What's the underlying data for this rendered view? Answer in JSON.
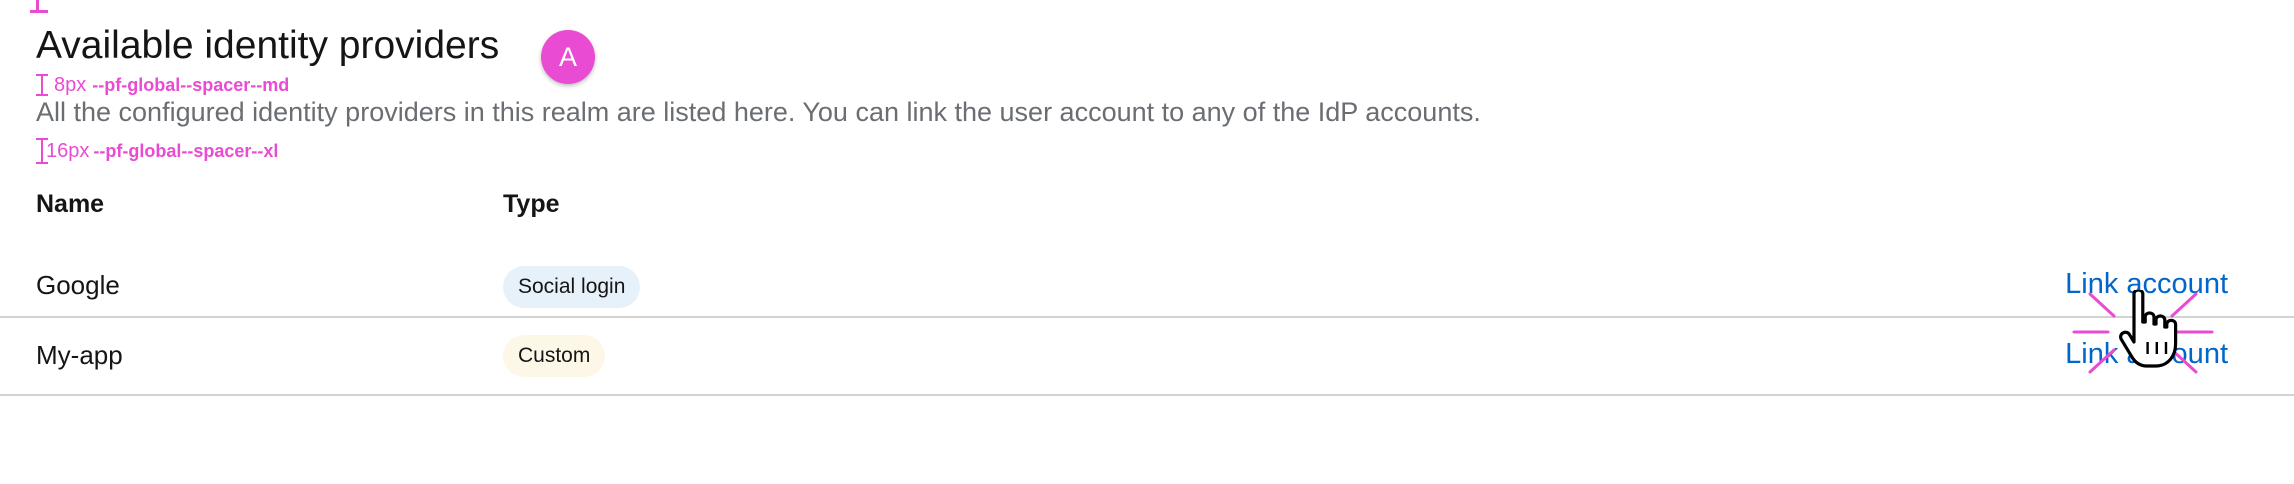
{
  "header": {
    "title": "Available identity providers",
    "callout": "A",
    "description": "All the configured identity providers in this realm are listed here. You can link the user account to any of the IdP accounts."
  },
  "annotations": {
    "spacer_md": {
      "value": "8px",
      "variable": "--pf-global--spacer--md"
    },
    "spacer_xl": {
      "value": "16px",
      "variable": "--pf-global--spacer--xl"
    }
  },
  "table": {
    "columns": [
      "Name",
      "Type"
    ],
    "rows": [
      {
        "name": "Google",
        "type": "Social login",
        "action": "Link account"
      },
      {
        "name": "My-app",
        "type": "Custom",
        "action": "Link account"
      }
    ]
  },
  "colors": {
    "annotation": "#e94cd2",
    "link": "#0066cc",
    "social_label_bg": "#e7f1fa",
    "custom_label_bg": "#fdf7e7",
    "description_text": "#6a6e73"
  },
  "icons": {
    "cursor": "hand-pointer-icon",
    "click": "click-burst-icon"
  }
}
